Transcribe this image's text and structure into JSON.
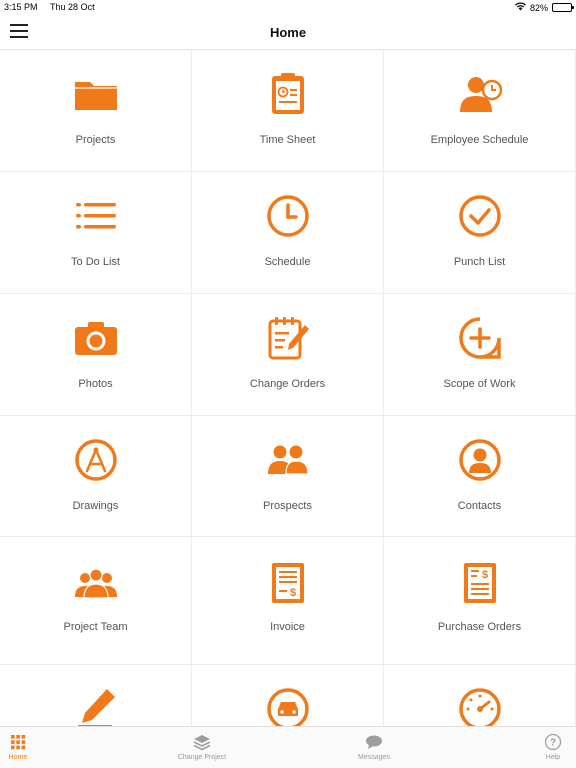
{
  "colors": {
    "accent": "#f07a1a",
    "inactive_tab": "#9e9e9e",
    "divider": "#ececec"
  },
  "status_bar": {
    "time": "3:15 PM",
    "date": "Thu 28 Oct",
    "battery": "82%",
    "battery_level": 0.82
  },
  "nav": {
    "title": "Home"
  },
  "tiles": [
    {
      "label": "Projects",
      "icon": "folder-icon"
    },
    {
      "label": "Time Sheet",
      "icon": "clipboard-clock-icon"
    },
    {
      "label": "Employee Schedule",
      "icon": "person-clock-icon"
    },
    {
      "label": "To Do List",
      "icon": "list-icon"
    },
    {
      "label": "Schedule",
      "icon": "clock-icon"
    },
    {
      "label": "Punch List",
      "icon": "check-circle-icon"
    },
    {
      "label": "Photos",
      "icon": "camera-icon"
    },
    {
      "label": "Change Orders",
      "icon": "notepad-pencil-icon"
    },
    {
      "label": "Scope of Work",
      "icon": "plus-circle-icon"
    },
    {
      "label": "Drawings",
      "icon": "compass-icon"
    },
    {
      "label": "Prospects",
      "icon": "two-people-icon"
    },
    {
      "label": "Contacts",
      "icon": "contact-circle-icon"
    },
    {
      "label": "Project Team",
      "icon": "team-icon"
    },
    {
      "label": "Invoice",
      "icon": "invoice-icon"
    },
    {
      "label": "Purchase Orders",
      "icon": "purchase-order-icon"
    },
    {
      "label": "",
      "icon": "pencil-icon"
    },
    {
      "label": "",
      "icon": "car-circle-icon"
    },
    {
      "label": "",
      "icon": "gauge-icon"
    }
  ],
  "tab_bar": {
    "tabs": [
      {
        "label": "Home",
        "icon": "grid-icon",
        "active": true
      },
      {
        "label": "Change Project",
        "icon": "layers-icon",
        "active": false
      },
      {
        "label": "Messages",
        "icon": "chat-bubble-icon",
        "active": false
      },
      {
        "label": "Help",
        "icon": "help-circle-icon",
        "active": false
      }
    ]
  }
}
